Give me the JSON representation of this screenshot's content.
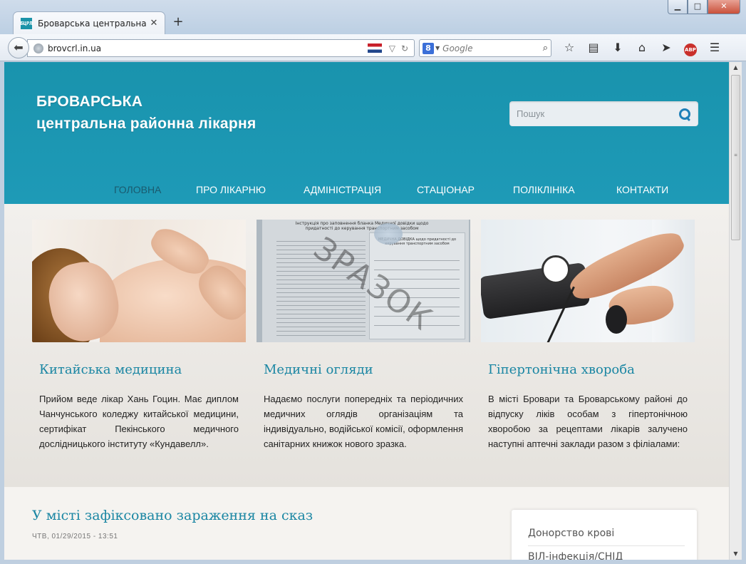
{
  "browser": {
    "tab_title": "Броварська центральна р...",
    "tab_close": "✕",
    "new_tab": "+",
    "favicon_text": "БЦРЛ",
    "url": "brovcrl.in.ua",
    "search_placeholder": "Google",
    "search_engine_icon": "8",
    "abp_label": "ABP",
    "window_buttons": {
      "minimize": "▁",
      "maximize": "□",
      "close": "✕"
    },
    "toolbar_icons": [
      "star-icon",
      "reading-list-icon",
      "download-icon",
      "home-icon",
      "send-icon",
      "adblock-icon",
      "menu-icon"
    ]
  },
  "site": {
    "title_line1": "БРОВАРСЬКА",
    "title_line2": "центральна районна лікарня",
    "search_placeholder": "Пошук",
    "menu": [
      "ГОЛОВНА",
      "ПРО ЛІКАРНЮ",
      "АДМІНІСТРАЦІЯ",
      "СТАЦІОНАР",
      "ПОЛІКЛІНІКА",
      "КОНТАКТИ"
    ],
    "menu_active_index": 0,
    "accent_color": "#1a86a3",
    "header_color": "#1993ad"
  },
  "features": [
    {
      "title": "Китайська медицина",
      "text": "Прийом веде лікар Хань Гоцин. Має диплом Чанчунського коледжу китайської медицини, сертифікат Пекінського медичного дослідницького інституту «Кундавелл»."
    },
    {
      "title": "Медичні огляди",
      "text": "Надаємо послуги попередніх та періодичних медичних оглядів організаціям та індивідуально, водійської комісії, оформлення санітарних книжок нового зразка.",
      "image_text": {
        "doc_heading": "Інструкція про заповнення бланка Медичної довідки щодо придатності до керування транспортним засобом",
        "card_title": "МЕДИЧНА ДОВІДКА щодо придатності до керування транспортним засобом",
        "stamp": "ЗРАЗОК"
      }
    },
    {
      "title": "Гіпертонічна хвороба",
      "text": "В місті Бровари та Броварському районі до відпуску ліків особам з гіпертонічною хворобою за рецептами лікарів залучено наступні аптечні заклади разом з філіалами:"
    }
  ],
  "article": {
    "title": "У місті зафіксовано зараження на сказ",
    "date": "ЧТВ, 01/29/2015 - 13:51"
  },
  "sidebar": {
    "items": [
      "Донорство крові",
      "ВІЛ-інфекція/СНІД"
    ]
  }
}
